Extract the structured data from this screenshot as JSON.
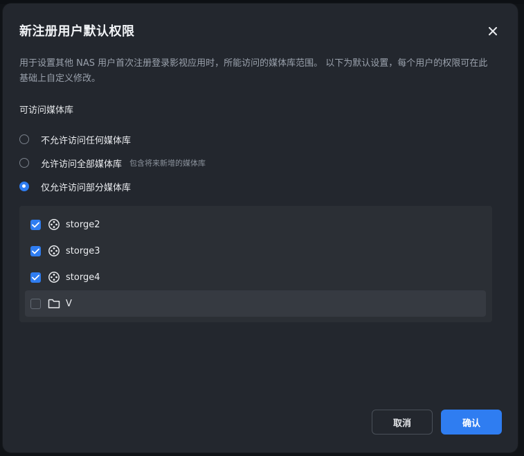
{
  "dialog": {
    "title": "新注册用户默认权限",
    "description": "用于设置其他 NAS 用户首次注册登录影视应用时，所能访问的媒体库范围。 以下为默认设置，每个用户的权限可在此基础上自定义修改。",
    "section_label": "可访问媒体库",
    "options": [
      {
        "label": "不允许访问任何媒体库",
        "hint": "",
        "selected": false
      },
      {
        "label": "允许访问全部媒体库",
        "hint": "包含将来新增的媒体库",
        "selected": false
      },
      {
        "label": "仅允许访问部分媒体库",
        "hint": "",
        "selected": true
      }
    ],
    "libraries": [
      {
        "name": "storge2",
        "icon": "film-reel-icon",
        "checked": true
      },
      {
        "name": "storge3",
        "icon": "film-reel-icon",
        "checked": true
      },
      {
        "name": "storge4",
        "icon": "film-reel-icon",
        "checked": true
      },
      {
        "name": "V",
        "icon": "folder-icon",
        "checked": false
      }
    ],
    "cancel_label": "取消",
    "confirm_label": "确认"
  },
  "colors": {
    "accent": "#2f7df1",
    "dialog_bg": "#23272e",
    "list_bg": "#2b2f35"
  }
}
